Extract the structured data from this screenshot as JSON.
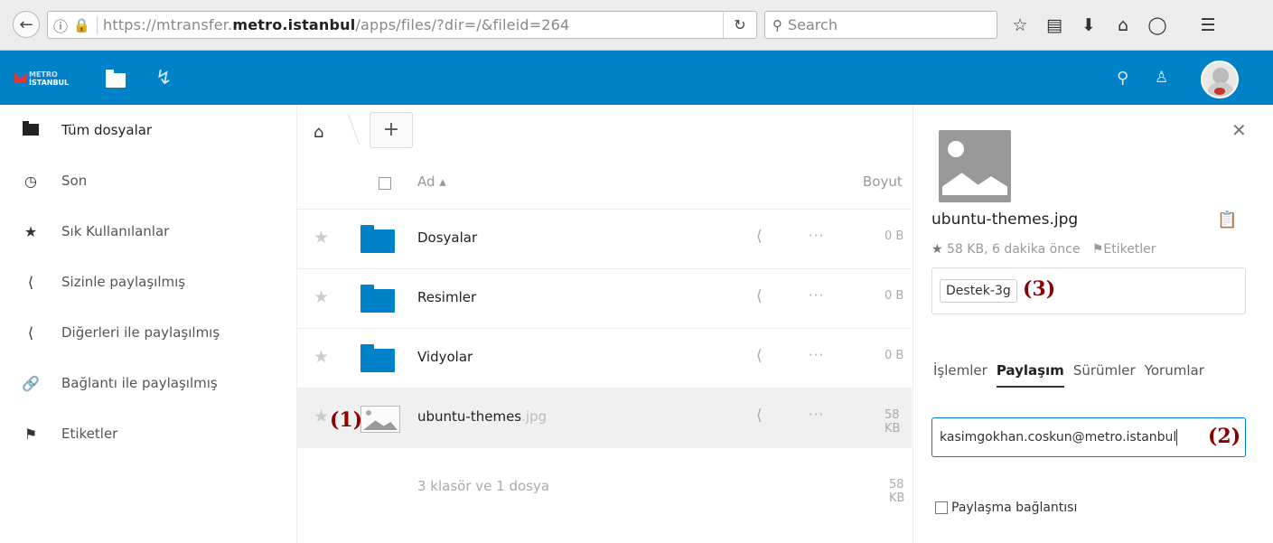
{
  "browser": {
    "back_icon": "back-arrow-icon",
    "url_host_prefix": "https://mtransfer.",
    "url_host_bold": "metro.istanbul",
    "url_path": "/apps/files/?dir=/&fileid=264",
    "search_placeholder": "Search"
  },
  "appbar": {
    "logo_line1": "METRO",
    "logo_line2": "İSTANBUL",
    "color": "#0082c9"
  },
  "sidebar": {
    "items": [
      {
        "label": "Tüm dosyalar",
        "icon": "folder-icon"
      },
      {
        "label": "Son",
        "icon": "clock-icon"
      },
      {
        "label": "Sık Kullanılanlar",
        "icon": "star-icon"
      },
      {
        "label": "Sizinle paylaşılmış",
        "icon": "share-icon"
      },
      {
        "label": "Diğerleri ile paylaşılmış",
        "icon": "share-icon"
      },
      {
        "label": "Bağlantı ile paylaşılmış",
        "icon": "link-icon"
      },
      {
        "label": "Etiketler",
        "icon": "tag-icon"
      }
    ]
  },
  "files": {
    "col_name": "Ad",
    "col_size": "Boyut",
    "rows": [
      {
        "name": "Dosyalar",
        "ext": "",
        "size": "0 B",
        "type": "folder"
      },
      {
        "name": "Resimler",
        "ext": "",
        "size": "0 B",
        "type": "folder"
      },
      {
        "name": "Vidyolar",
        "ext": "",
        "size": "0 B",
        "type": "folder"
      },
      {
        "name": "ubuntu-themes",
        "ext": ".jpg",
        "size": "58 KB",
        "type": "image"
      }
    ],
    "summary": "3 klasör ve 1 dosya",
    "summary_size": "58 KB"
  },
  "details": {
    "filename": "ubuntu-themes.jpg",
    "meta": "58 KB, 6 dakika önce",
    "tags_label": "Etiketler",
    "tag": "Destek-3g",
    "tabs": [
      "İşlemler",
      "Paylaşım",
      "Sürümler",
      "Yorumlar"
    ],
    "share_input_value": "kasimgokhan.coskun@metro.istanbul",
    "link_share_label": "Paylaşma bağlantısı"
  },
  "annotations": {
    "a1": "(1)",
    "a2": "(2)",
    "a3": "(3)"
  }
}
